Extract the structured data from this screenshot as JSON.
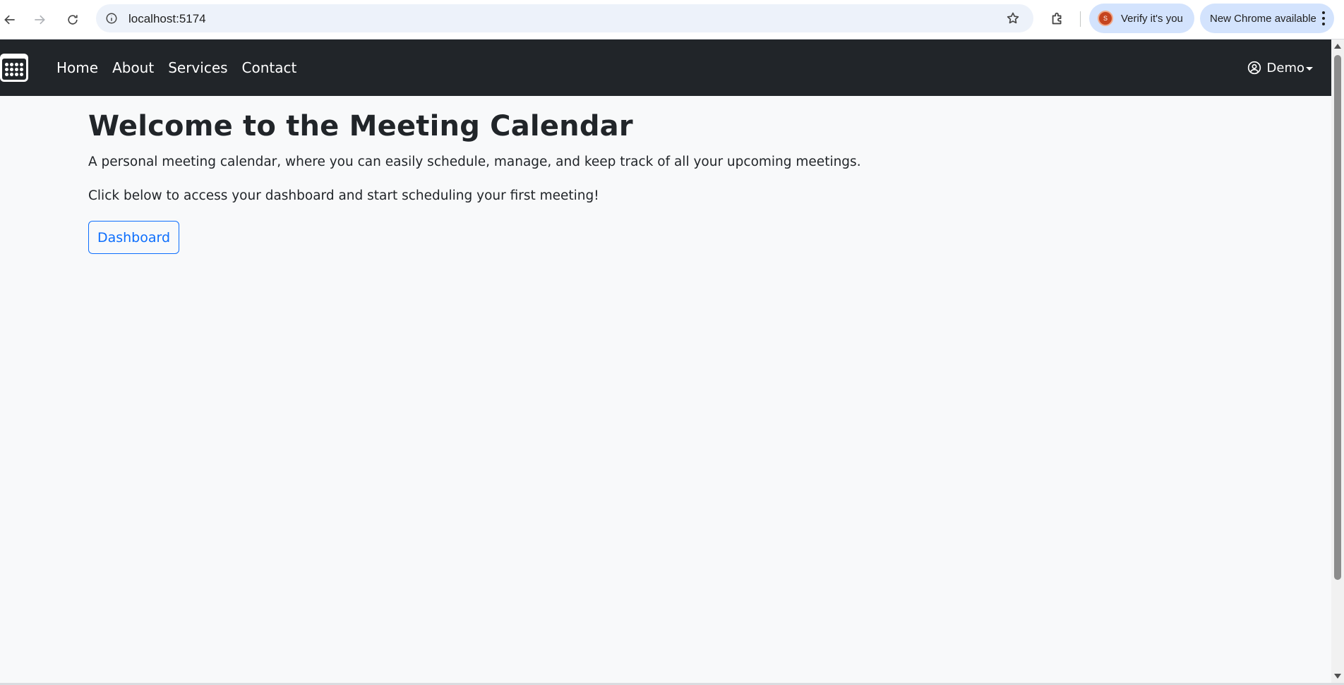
{
  "browser": {
    "url": "localhost:5174",
    "verify_chip_label": "Verify it's you",
    "verify_avatar_letter": "S",
    "update_chip_label": "New Chrome available",
    "icons": [
      "back-arrow-icon",
      "forward-arrow-icon",
      "reload-icon",
      "site-info-icon",
      "bookmark-star-icon",
      "extensions-icon",
      "kebab-menu-icon"
    ]
  },
  "navbar": {
    "background": "#212529",
    "links": [
      {
        "label": "Home"
      },
      {
        "label": "About"
      },
      {
        "label": "Services"
      },
      {
        "label": "Contact"
      }
    ],
    "user_label": "Demo"
  },
  "main": {
    "title": "Welcome to the Meeting Calendar",
    "lead": "A personal meeting calendar, where you can easily schedule, manage, and keep track of all your upcoming meetings.",
    "cta_text": "Click below to access your dashboard and start scheduling your first meeting!",
    "dashboard_button_label": "Dashboard",
    "accent_color": "#0d6efd"
  }
}
